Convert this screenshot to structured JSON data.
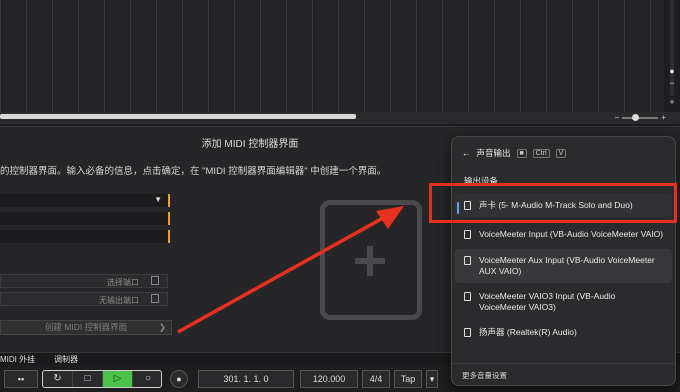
{
  "panel": {
    "title": "添加 MIDI 控制器界面",
    "description": "的控制器界面。输入必备的信息，点击确定，在 \"MIDI 控制器界面编辑器\" 中创建一个界面。",
    "select_input_port": "选择端口",
    "no_output_port": "无输出端口",
    "create_button": "创建 MIDI 控制器界面"
  },
  "bottom_tabs": [
    "MIDI 外挂",
    "调制器"
  ],
  "transport": {
    "position": "301. 1. 1.  0",
    "tempo": "120.000",
    "signature": "4/4",
    "tap": "Tap"
  },
  "flyout": {
    "header": "声音输出",
    "shortcut_keys": [
      "Ctrl",
      "V"
    ],
    "section_title": "输出设备",
    "devices": [
      "声卡 (5- M-Audio M-Track Solo and Duo)",
      "VoiceMeeter Input (VB-Audio VoiceMeeter VAIO)",
      "VoiceMeeter Aux Input (VB-Audio VoiceMeeter AUX VAIO)",
      "VoiceMeeter VAIO3 Input (VB-Audio VoiceMeeter VAIO3)",
      "扬声器 (Realtek(R) Audio)"
    ],
    "footer": "更多音量设置"
  },
  "colors": {
    "accent_orange": "#e8a03a",
    "highlight_red": "#e8301f",
    "play_green": "#4cc24a",
    "selected_indicator": "#5aa8ff"
  },
  "icons": [
    "back-arrow-icon",
    "speaker-icon",
    "plus-icon",
    "chevron-down-icon",
    "port-icon"
  ]
}
